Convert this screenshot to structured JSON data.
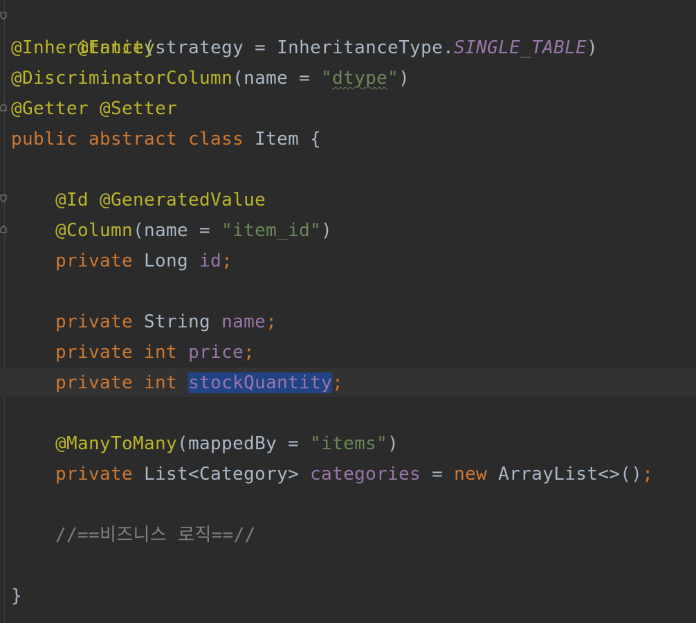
{
  "editor": {
    "colors": {
      "background": "#2b2b2b",
      "annotation": "#bbb529",
      "keyword": "#cc7832",
      "field": "#9876aa",
      "string": "#6a8759",
      "comment": "#808080",
      "text": "#a9b7c6",
      "selection": "#214283"
    },
    "code": {
      "l1": {
        "ann": "@Entity"
      },
      "l2": {
        "ann": "@Inheritance",
        "open": "(strategy = InheritanceType.",
        "enum": "SINGLE_TABLE",
        "close": ")"
      },
      "l3": {
        "ann": "@DiscriminatorColumn",
        "open": "(name = ",
        "str_q1": "\"",
        "str_word": "dtype",
        "str_q2": "\"",
        "close": ")"
      },
      "l4": {
        "ann1": "@Getter",
        "sp": " ",
        "ann2": "@Setter"
      },
      "l5": {
        "kw": "public abstract class",
        "rest": " Item {"
      },
      "l6": {
        "ann1": "@Id",
        "sp": " ",
        "ann2": "@GeneratedValue"
      },
      "l7": {
        "ann": "@Column",
        "open": "(name = ",
        "str": "\"item_id\"",
        "close": ")"
      },
      "l8": {
        "kw": "private",
        "type": " Long ",
        "field": "id",
        "semi": ";"
      },
      "l9": {
        "kw": "private",
        "type": " String ",
        "field": "name",
        "semi": ";"
      },
      "l10": {
        "kw": "private int",
        "sp": " ",
        "field": "price",
        "semi": ";"
      },
      "l11": {
        "kw": "private int",
        "sp": " ",
        "field": "stockQuantity",
        "semi": ";"
      },
      "l12": {
        "ann": "@ManyToMany",
        "open": "(mappedBy = ",
        "str": "\"items\"",
        "close": ")"
      },
      "l13": {
        "kw": "private",
        "type": " List<Category> ",
        "field": "categories",
        "eq": " = ",
        "kw2": "new",
        "rest": " ArrayList<>()",
        "semi": ";"
      },
      "l14": {
        "comment": "//==비즈니스 로직==//"
      },
      "l15": {
        "brace": "}"
      }
    }
  }
}
